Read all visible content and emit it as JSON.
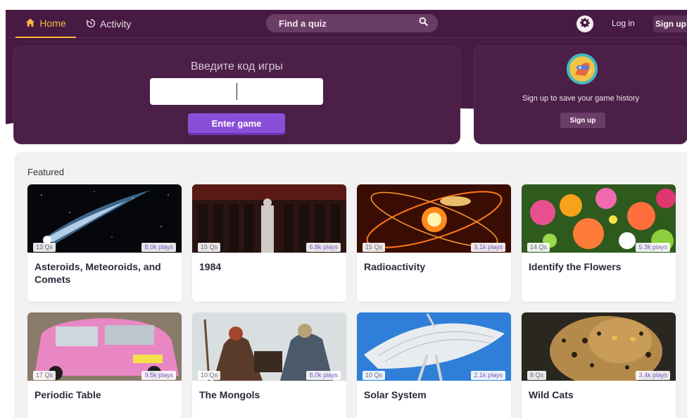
{
  "nav": {
    "home_label": "Home",
    "activity_label": "Activity",
    "search_placeholder": "Find a quiz",
    "login_label": "Log in",
    "signup_label": "Sign up"
  },
  "join": {
    "title": "Введите код игры",
    "input_value": "",
    "button_label": "Enter game"
  },
  "signup_card": {
    "text": "Sign up to save your game history",
    "button_label": "Sign up"
  },
  "featured": {
    "title": "Featured",
    "cards": [
      {
        "questions": "13 Qs",
        "plays": "8.0k plays",
        "title": "Asteroids, Meteoroids, and Comets"
      },
      {
        "questions": "15 Qs",
        "plays": "6.8k plays",
        "title": "1984"
      },
      {
        "questions": "15 Qs",
        "plays": "9.1k plays",
        "title": "Radioactivity"
      },
      {
        "questions": "14 Qs",
        "plays": "5.3k plays",
        "title": "Identify the Flowers"
      },
      {
        "questions": "17 Qs",
        "plays": "9.5k plays",
        "title": "Periodic Table"
      },
      {
        "questions": "10 Qs",
        "plays": "8.0k plays",
        "title": "The Mongols"
      },
      {
        "questions": "10 Qs",
        "plays": "2.1k plays",
        "title": "Solar System"
      },
      {
        "questions": "8 Qs",
        "plays": "3.4k plays",
        "title": "Wild Cats"
      }
    ]
  },
  "colors": {
    "header_bg": "#461a42",
    "card_bg": "#4b1f47",
    "accent_orange": "#f6b93b",
    "primary_button": "#8a4fd8",
    "plays_text": "#7a55c9"
  },
  "icons": {
    "home": "home-icon",
    "activity": "history-icon",
    "search": "search-icon",
    "settings": "gear-icon",
    "mascot": "mascot-avatar"
  }
}
